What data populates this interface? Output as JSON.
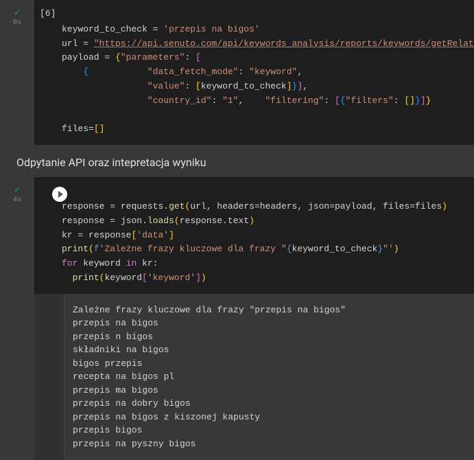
{
  "cell1": {
    "status": "✓",
    "timing": "0s",
    "exec_count": "[6]",
    "code": {
      "l1_var": "keyword_to_check",
      "l1_str": "'przepis na bigos'",
      "l2_var": "url",
      "l2_str": "\"https://api.senuto.com/api/keywords_analysis/reports/keywords/getRelated\"",
      "l3_var": "payload",
      "l3_k1": "\"parameters\"",
      "l4_k1": "\"data_fetch_mode\"",
      "l4_v1": "\"keyword\"",
      "l5_k1": "\"value\"",
      "l5_v1": "keyword_to_check",
      "l6_k1": "\"country_id\"",
      "l6_v1": "\"1\"",
      "l6_k2": "\"filtering\"",
      "l6_k3": "\"filters\"",
      "l8_var": "files"
    }
  },
  "section_title": "Odpytanie API oraz intepretacja wyniku",
  "cell2": {
    "status": "✓",
    "timing": "4s",
    "code": {
      "l1_var": "response",
      "l1_mod": "requests",
      "l1_fn": "get",
      "l1_a1": "url",
      "l1_p1": "headers",
      "l1_p1v": "headers",
      "l1_p2": "json",
      "l1_p2v": "payload",
      "l1_p3": "files",
      "l1_p3v": "files",
      "l2_var": "response",
      "l2_mod": "json",
      "l2_fn": "loads",
      "l2_arg": "response.text",
      "l3_var": "kr",
      "l3_src": "response",
      "l3_key": "'data'",
      "l4_fn": "print",
      "l4_fpre": "f",
      "l4_str1": "'Zależne frazy kluczowe dla frazy \"",
      "l4_expr": "keyword_to_check",
      "l4_str2": "\"'",
      "l5_kw1": "for",
      "l5_var": "keyword",
      "l5_kw2": "in",
      "l5_iter": "kr",
      "l6_fn": "print",
      "l6_src": "keyword",
      "l6_key": "'keyword'"
    },
    "output_lines": [
      "Zależne frazy kluczowe dla frazy \"przepis na bigos\"",
      "przepis na bigos",
      "przepis n bigos",
      "składniki na bigos",
      "bigos przepis",
      "recepta na bigos pl",
      "przepis ma bigos",
      "przepis na dobry bigos",
      "przepis na bigos z kiszonej kapusty",
      "przepis bigos",
      "przepis na pyszny bigos"
    ]
  }
}
